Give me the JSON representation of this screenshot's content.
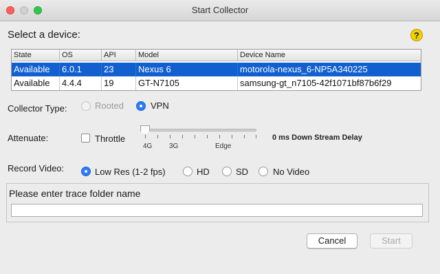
{
  "window": {
    "title": "Start Collector"
  },
  "heading": "Select a device:",
  "help_icon_glyph": "?",
  "device_table": {
    "columns": [
      "State",
      "OS",
      "API",
      "Model",
      "Device Name"
    ],
    "rows": [
      {
        "state": "Available",
        "os": "6.0.1",
        "api": "23",
        "model": "Nexus 6",
        "device_name": "motorola-nexus_6-NP5A340225",
        "selected": true
      },
      {
        "state": "Available",
        "os": "4.4.4",
        "api": "19",
        "model": "GT-N7105",
        "device_name": "samsung-gt_n7105-42f1071bf87b6f29",
        "selected": false
      }
    ]
  },
  "collector_type": {
    "label": "Collector Type:",
    "options": [
      {
        "label": "Rooted",
        "selected": false,
        "enabled": false
      },
      {
        "label": "VPN",
        "selected": true,
        "enabled": true
      }
    ]
  },
  "attenuate": {
    "label": "Attenuate:",
    "throttle_label": "Throttle",
    "throttle_checked": false,
    "slider_ticks": [
      "4G",
      "3G",
      "Edge"
    ],
    "slider_value_fraction": 0,
    "delay_text": "0 ms Down Stream Delay"
  },
  "record_video": {
    "label": "Record Video:",
    "options": [
      {
        "label": "Low Res (1-2 fps)",
        "selected": true
      },
      {
        "label": "HD",
        "selected": false
      },
      {
        "label": "SD",
        "selected": false
      },
      {
        "label": "No Video",
        "selected": false
      }
    ]
  },
  "trace_folder": {
    "label": "Please enter trace folder name",
    "value": ""
  },
  "buttons": {
    "cancel": "Cancel",
    "start": "Start"
  },
  "colors": {
    "selection": "#1260d0",
    "radio_on": "#2d7cf6",
    "help": "#f4d000"
  }
}
